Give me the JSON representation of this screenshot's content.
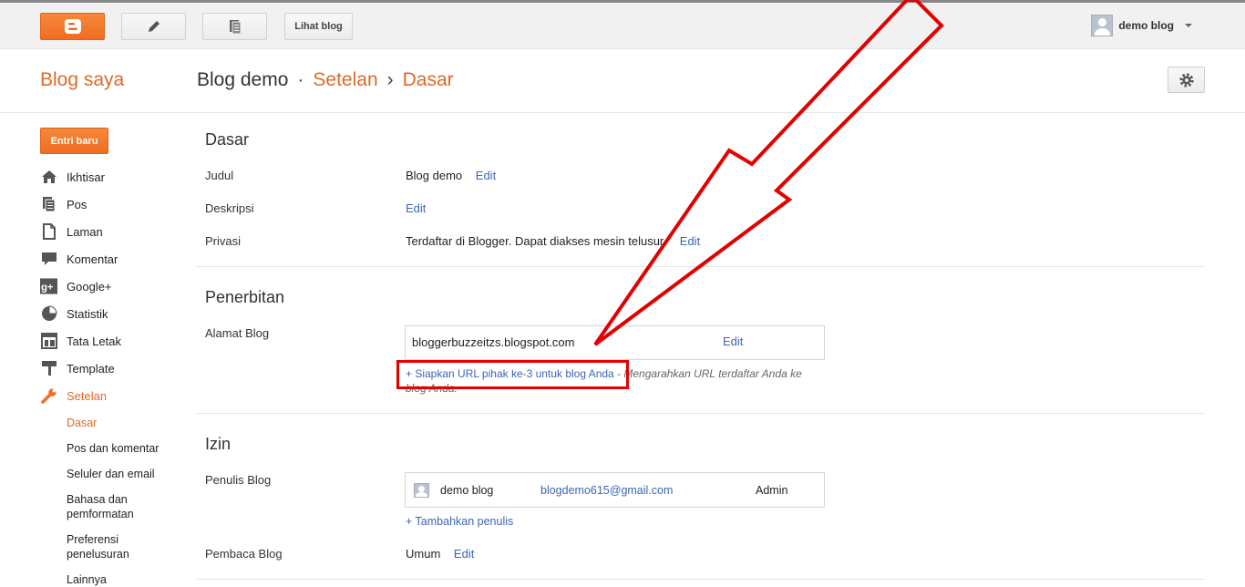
{
  "topbar": {
    "view_blog_label": "Lihat blog",
    "user_name": "demo blog"
  },
  "header": {
    "blog_saya": "Blog saya",
    "breadcrumb": [
      "Blog demo",
      "Setelan",
      "Dasar"
    ]
  },
  "sidebar": {
    "new_post_label": "Entri baru",
    "items": [
      {
        "label": "Ikhtisar",
        "icon": "home-icon"
      },
      {
        "label": "Pos",
        "icon": "posts-icon"
      },
      {
        "label": "Laman",
        "icon": "pages-icon"
      },
      {
        "label": "Komentar",
        "icon": "comment-icon"
      },
      {
        "label": "Google+",
        "icon": "google-plus-icon"
      },
      {
        "label": "Statistik",
        "icon": "stats-icon"
      },
      {
        "label": "Tata Letak",
        "icon": "layout-icon"
      },
      {
        "label": "Template",
        "icon": "template-icon"
      },
      {
        "label": "Setelan",
        "icon": "wrench-icon"
      }
    ],
    "sub_items": [
      "Dasar",
      "Pos dan komentar",
      "Seluler dan email",
      "Bahasa dan pemformatan",
      "Preferensi penelusuran",
      "Lainnya"
    ]
  },
  "main": {
    "basic": {
      "title": "Dasar",
      "judul_label": "Judul",
      "judul_value": "Blog demo",
      "deskripsi_label": "Deskripsi",
      "privasi_label": "Privasi",
      "privasi_value": "Terdaftar di Blogger. Dapat diakses mesin telusur.",
      "edit": "Edit"
    },
    "publishing": {
      "title": "Penerbitan",
      "address_label": "Alamat Blog",
      "address_value": "bloggerbuzzeitzs.blogspot.com",
      "third_party_link": "+ Siapkan URL pihak ke-3 untuk blog Anda",
      "third_party_hint": " - Mengarahkan URL terdaftar Anda ke blog Anda."
    },
    "permissions": {
      "title": "Izin",
      "authors_label": "Penulis Blog",
      "author_name": "demo blog",
      "author_email": "blogdemo615@gmail.com",
      "author_role": "Admin",
      "add_author_link": "+ Tambahkan penulis",
      "readers_label": "Pembaca Blog",
      "readers_value": "Umum"
    }
  },
  "colors": {
    "accent_orange": "#dd6a28",
    "link_blue": "#3b66b6",
    "annotation_red": "#e30000"
  }
}
